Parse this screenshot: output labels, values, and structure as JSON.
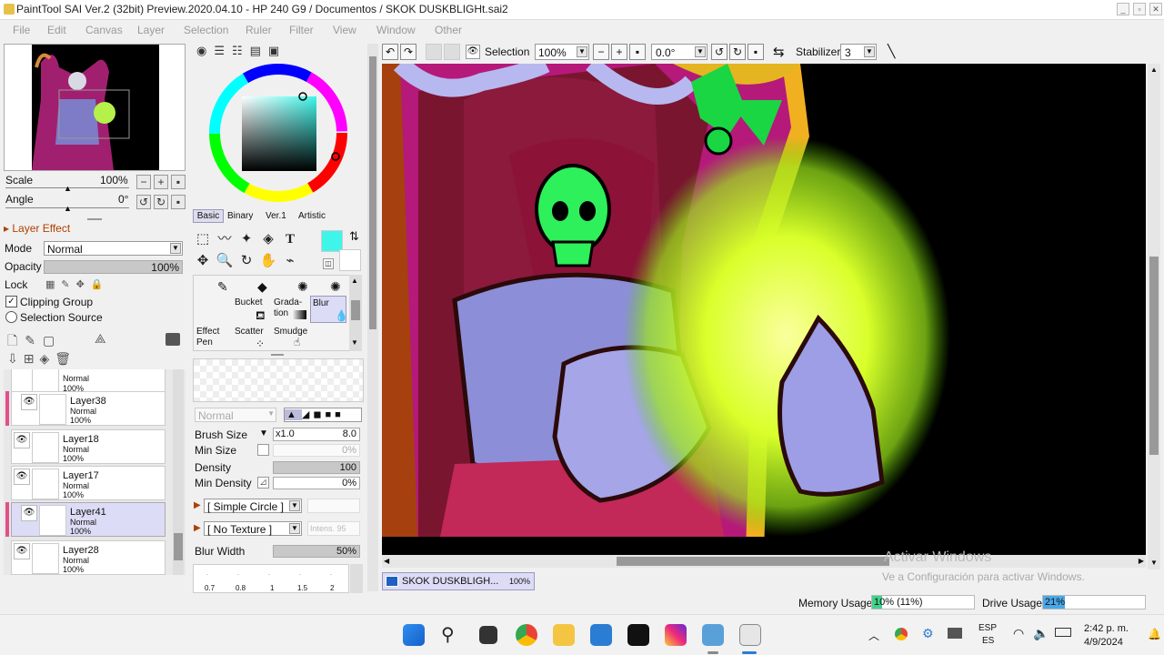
{
  "window": {
    "title": "PaintTool SAI Ver.2 (32bit) Preview.2020.04.10 - HP 240 G9 / Documentos / SKOK DUSKBLIGHt.sai2"
  },
  "menu": [
    "File",
    "Edit",
    "Canvas",
    "Layer",
    "Selection",
    "Ruler",
    "Filter",
    "View",
    "Window",
    "Other"
  ],
  "navigator": {
    "scale_label": "Scale",
    "scale_value": "100%",
    "angle_label": "Angle",
    "angle_value": "0°"
  },
  "layer_effect": {
    "header": "Layer Effect",
    "mode_label": "Mode",
    "mode_value": "Normal",
    "opacity_label": "Opacity",
    "opacity_value": "100%",
    "lock_label": "Lock",
    "clipping_label": "Clipping Group",
    "selection_source_label": "Selection Source"
  },
  "layers": [
    {
      "name": "",
      "mode": "Normal",
      "opacity": "100%"
    },
    {
      "name": "Layer38",
      "mode": "Normal",
      "opacity": "100%"
    },
    {
      "name": "Layer18",
      "mode": "Normal",
      "opacity": "100%"
    },
    {
      "name": "Layer17",
      "mode": "Normal",
      "opacity": "100%"
    },
    {
      "name": "Layer41",
      "mode": "Normal",
      "opacity": "100%"
    },
    {
      "name": "Layer28",
      "mode": "Normal",
      "opacity": "100%"
    }
  ],
  "color_tabs": [
    "Basic",
    "Binary",
    "Ver.1",
    "Artistic"
  ],
  "current_color": "#3ff5ea",
  "brushes": {
    "row1": [
      "",
      "",
      "",
      ""
    ],
    "row2": [
      "Bucket",
      "Grada-\ntion",
      "Blur",
      ""
    ],
    "row3": [
      "Effect\nPen",
      "Scatter",
      "Smudge",
      ""
    ],
    "blend_mode": "Normal"
  },
  "brush_settings": {
    "brush_size_label": "Brush Size",
    "brush_size_mult": "x1.0",
    "brush_size_value": "8.0",
    "min_size_label": "Min Size",
    "min_size_value": "0%",
    "density_label": "Density",
    "density_value": "100",
    "min_density_label": "Min Density",
    "min_density_value": "0%",
    "shape": "[ Simple Circle ]",
    "texture": "[ No Texture ]",
    "texture_intensity": "Intens.  95",
    "blur_width_label": "Blur Width",
    "blur_width_value": "50%",
    "presets": [
      "0.7",
      "0.8",
      "1",
      "1.5",
      "2"
    ]
  },
  "canvas_toolbar": {
    "selection_label": "Selection",
    "zoom_value": "100%",
    "angle_value": "0.0°",
    "stabilizer_label": "Stabilizer",
    "stabilizer_value": "3"
  },
  "doc_tab": {
    "name": "SKOK DUSKBLIGH...",
    "zoom": "100%"
  },
  "watermark": {
    "line1": "Activar Windows",
    "line2": "Ve a Configuración para activar Windows."
  },
  "status": {
    "memory_label": "Memory Usage",
    "memory_value": "10% (11%)",
    "memory_fraction": 0.1,
    "drive_label": "Drive Usage",
    "drive_value": "21%",
    "drive_fraction": 0.21
  },
  "taskbar": {
    "lang1": "ESP",
    "lang2": "ES",
    "time": "2:42 p. m.",
    "date": "4/9/2024"
  }
}
